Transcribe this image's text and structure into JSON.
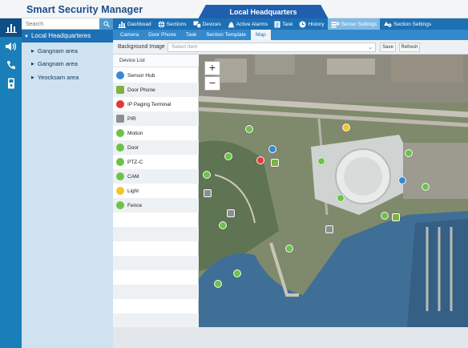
{
  "app": {
    "title": "Smart Security Manager",
    "location_tab": "Local Headquarters"
  },
  "rail": {
    "icons": [
      "bar-chart-icon",
      "speaker-icon",
      "phone-icon",
      "door-phone-icon"
    ]
  },
  "sidebar": {
    "search_placeholder": "Search",
    "root": "Local Headquarteres",
    "children": [
      {
        "label": "Gangnam area"
      },
      {
        "label": "Gangnam area"
      },
      {
        "label": "Yeocksam area"
      }
    ]
  },
  "nav": {
    "items": [
      {
        "label": "Dashboad",
        "icon": "dashboard-icon"
      },
      {
        "label": "Sections",
        "icon": "globe-icon"
      },
      {
        "label": "Devices",
        "icon": "devices-icon"
      },
      {
        "label": "Active Alarms",
        "icon": "alarm-icon"
      },
      {
        "label": "Task",
        "icon": "task-icon"
      },
      {
        "label": "History",
        "icon": "clock-icon"
      },
      {
        "label": "Server Settings",
        "icon": "server-settings-icon"
      },
      {
        "label": "Section Settings",
        "icon": "section-settings-icon"
      }
    ],
    "active_index": 6
  },
  "subtabs": {
    "items": [
      "Camera",
      "Door Phone",
      "Task",
      "Section Template",
      "Map"
    ],
    "active_index": 4
  },
  "toolbar": {
    "background_label": "Background Image",
    "select_placeholder": "Select Item",
    "save_label": "Save",
    "refresh_label": "Refresh"
  },
  "device_list": {
    "header": "Device List",
    "items": [
      {
        "label": "Sensor Hub",
        "icon": "sensor-hub-icon",
        "color": "#3a87d6"
      },
      {
        "label": "Door Phone",
        "icon": "door-phone-icon",
        "color": "#7cb342"
      },
      {
        "label": "IP Paging Terminal",
        "icon": "speaker-icon",
        "color": "#e53935"
      },
      {
        "label": "PIR",
        "icon": "pir-icon",
        "color": "#8a8f94"
      },
      {
        "label": "Motion",
        "icon": "motion-icon",
        "color": "#6cc24a"
      },
      {
        "label": "Door",
        "icon": "door-icon",
        "color": "#6cc24a"
      },
      {
        "label": "PTZ-C",
        "icon": "ptz-camera-icon",
        "color": "#6cc24a"
      },
      {
        "label": "CAM",
        "icon": "camera-icon",
        "color": "#6cc24a"
      },
      {
        "label": "Light",
        "icon": "light-bulb-icon",
        "color": "#f2c623"
      },
      {
        "label": "Fence",
        "icon": "fence-icon",
        "color": "#6cc24a"
      }
    ]
  },
  "map": {
    "zoom_in": "+",
    "zoom_out": "−"
  },
  "colors": {
    "header_blue": "#1d70b4",
    "rail_blue": "#1a7fb8",
    "title_blue": "#1c4d8c",
    "marker_green": "#6cc24a",
    "marker_red": "#e53935",
    "marker_yellow": "#f2c623",
    "marker_blue": "#3a87d6",
    "marker_gray": "#8a8f94"
  }
}
